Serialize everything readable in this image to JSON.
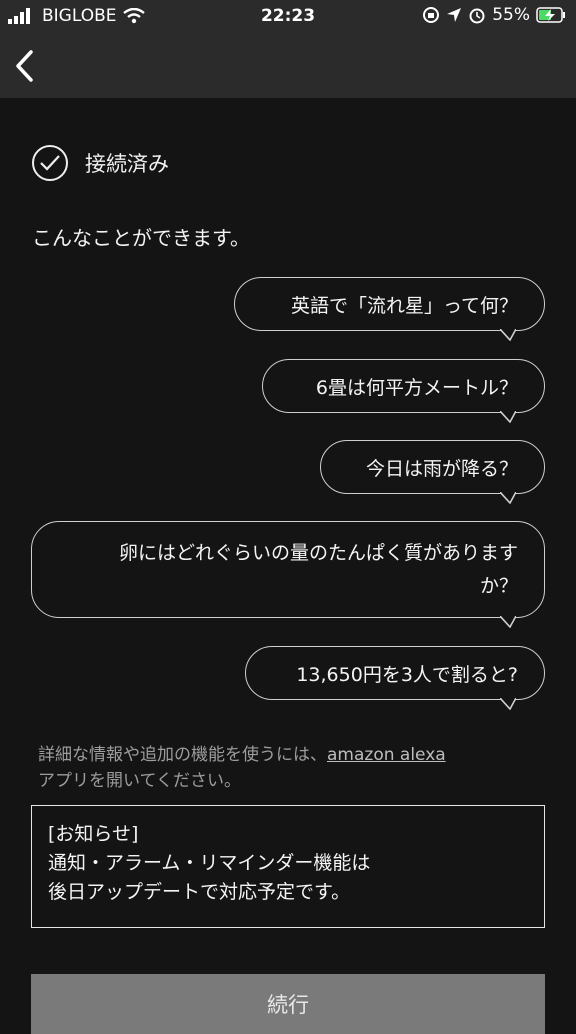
{
  "status_bar": {
    "carrier": "BIGLOBE",
    "time": "22:23",
    "battery": "55%"
  },
  "connection": {
    "label": "接続済み"
  },
  "intro_text": "こんなことができます。",
  "examples": [
    "英語で「流れ星」って何？",
    "6畳は何平方メートル？",
    "今日は雨が降る？",
    "卵にはどれぐらいの量のたんぱく質がありますか？",
    "13,650円を3人で割ると?"
  ],
  "footer": {
    "before_link": "詳細な情報や追加の機能を使うには、",
    "link": "amazon alexa",
    "after_link": "アプリを開いてください。"
  },
  "notice": {
    "title": "[お知らせ]",
    "line1": "通知・アラーム・リマインダー機能は",
    "line2": "後日アップデートで対応予定です。"
  },
  "continue_label": "続行"
}
